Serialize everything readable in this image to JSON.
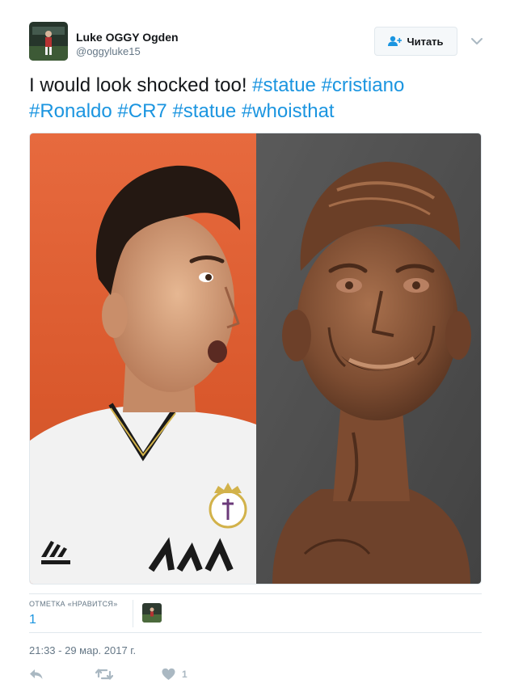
{
  "tweet": {
    "author_name": "Luke OGGY Ogden",
    "author_handle": "@oggyluke15",
    "text_plain": "I would look shocked too! ",
    "hashtags": [
      "#statue",
      "#cristiano",
      "#Ronaldo",
      "#CR7",
      "#statue",
      "#whoisthat"
    ],
    "timestamp": "21:33 - 29 мар. 2017 г."
  },
  "follow": {
    "label": "Читать",
    "icon": "add-user-icon"
  },
  "stats": {
    "likes_label": "ОТМЕТКА «НРАВИТСЯ»",
    "likes_count": "1"
  },
  "actions": {
    "reply_icon": "reply-icon",
    "retweet_icon": "retweet-icon",
    "like_icon": "heart-icon",
    "like_count": "1"
  },
  "colors": {
    "link": "#1b95e0",
    "text": "#14171a",
    "muted": "#657786",
    "action": "#aab8c2",
    "border": "#e1e8ed"
  }
}
